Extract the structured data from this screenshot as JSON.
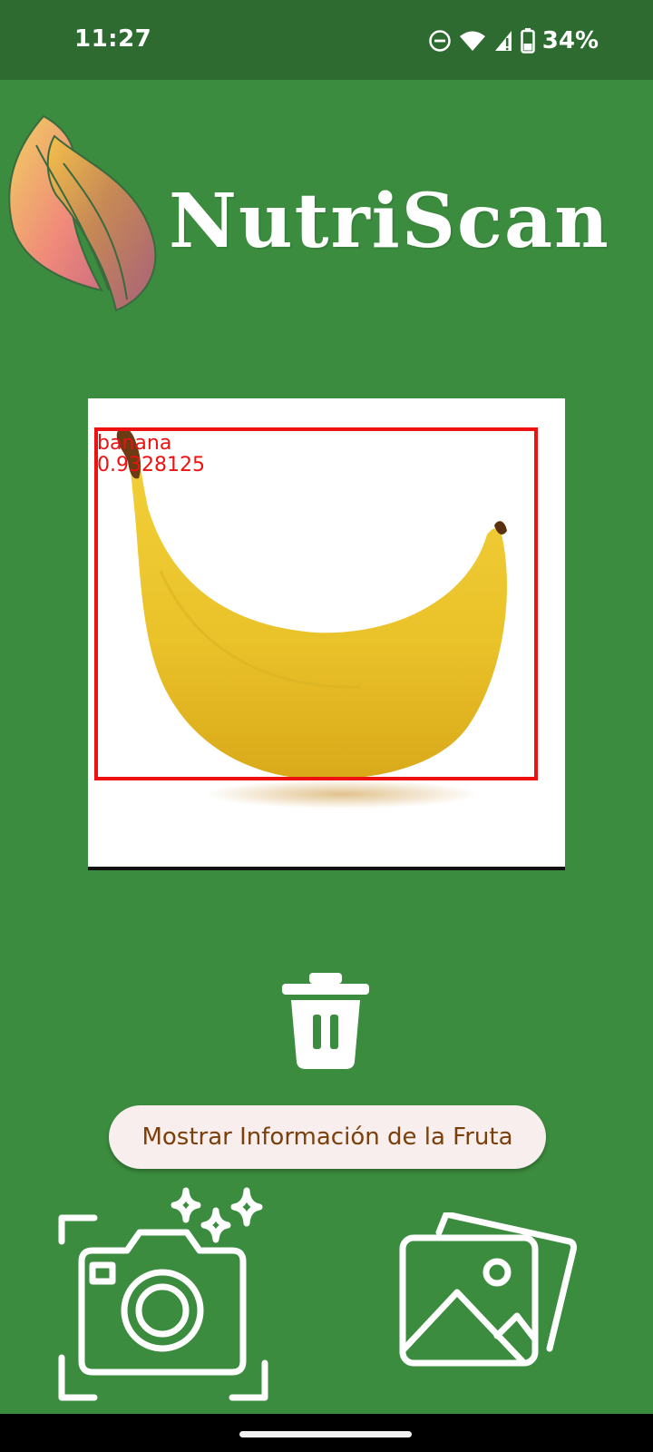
{
  "status_bar": {
    "time": "11:27",
    "battery": "34%",
    "icons": [
      "do-not-disturb-icon",
      "wifi-icon",
      "signal-icon",
      "battery-icon"
    ]
  },
  "app": {
    "name": "NutriScan"
  },
  "detection": {
    "label": "banana",
    "score": "0.9328125",
    "box_color": "#ee1111"
  },
  "actions": {
    "info_button_label": "Mostrar Información de la Fruta",
    "delete_icon": "trash-icon",
    "camera_icon": "camera-sparkle-icon",
    "gallery_icon": "gallery-icon"
  },
  "colors": {
    "background": "#3b8c3e",
    "status_bar": "#2e6b31",
    "button_bg": "#f8eeee",
    "button_text": "#7b3f0a"
  }
}
